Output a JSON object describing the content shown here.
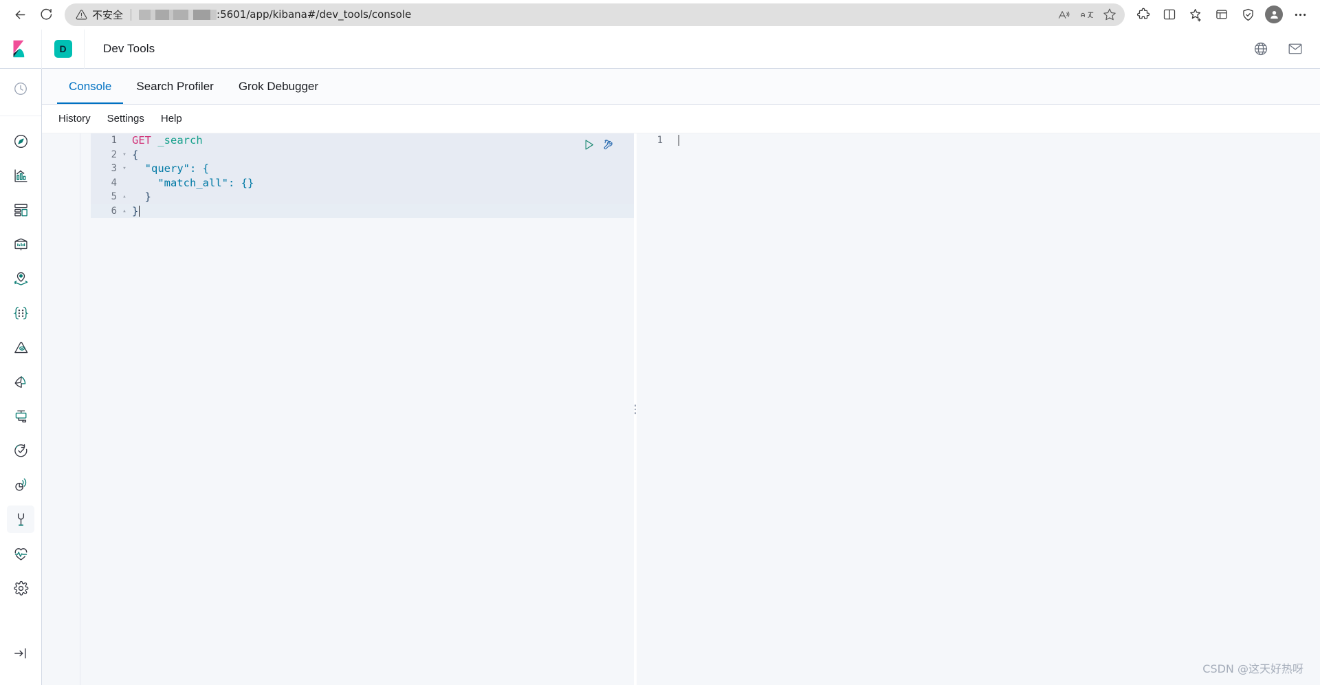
{
  "browser": {
    "back_label": "Back",
    "reload_label": "Refresh",
    "security_warning": "不安全",
    "url_text": ":5601/app/kibana#/dev_tools/console",
    "url_redacted": true,
    "addr_icons": [
      {
        "name": "read-aloud-icon",
        "glyph": "A"
      },
      {
        "name": "translate-icon",
        "glyph": "aあ"
      },
      {
        "name": "favorite-star-icon",
        "glyph": "☆"
      }
    ],
    "toolbar_icons": [
      {
        "name": "extensions-icon"
      },
      {
        "name": "split-screen-icon"
      },
      {
        "name": "favorites-icon"
      },
      {
        "name": "collections-icon"
      },
      {
        "name": "browser-essentials-icon"
      },
      {
        "name": "profile-avatar"
      },
      {
        "name": "settings-more-icon"
      }
    ]
  },
  "kibana_header": {
    "logo_name": "kibana-logo",
    "app_badge": "D",
    "title": "Dev Tools",
    "right_icons": [
      {
        "name": "help-globe-icon"
      },
      {
        "name": "news-feed-icon"
      }
    ]
  },
  "sidebar": {
    "top_item": {
      "label": "Recently viewed",
      "icon": "clock-icon"
    },
    "items": [
      {
        "label": "Discover",
        "icon": "compass-icon",
        "active": false
      },
      {
        "label": "Visualize",
        "icon": "visualize-chart-icon",
        "active": false
      },
      {
        "label": "Dashboard",
        "icon": "dashboard-grid-icon",
        "active": false
      },
      {
        "label": "Canvas",
        "icon": "canvas-presentation-icon",
        "active": false
      },
      {
        "label": "Maps",
        "icon": "maps-pin-layers-icon",
        "active": false
      },
      {
        "label": "Machine Learning",
        "icon": "machine-learning-icon",
        "active": false
      },
      {
        "label": "Infrastructure",
        "icon": "infrastructure-icon",
        "active": false
      },
      {
        "label": "Logs",
        "icon": "logs-icon",
        "active": false
      },
      {
        "label": "APM",
        "icon": "apm-icon",
        "active": false
      },
      {
        "label": "Uptime",
        "icon": "uptime-check-icon",
        "active": false
      },
      {
        "label": "SIEM",
        "icon": "siem-signal-icon",
        "active": false
      },
      {
        "label": "Dev Tools",
        "icon": "wrench-icon",
        "active": true
      },
      {
        "label": "Monitoring",
        "icon": "heartbeat-icon",
        "active": false
      },
      {
        "label": "Management",
        "icon": "gear-icon",
        "active": false
      }
    ],
    "collapse": {
      "label": "Collapse",
      "icon": "dock-collapse-icon"
    }
  },
  "tabs": [
    {
      "label": "Console",
      "active": true
    },
    {
      "label": "Search Profiler",
      "active": false
    },
    {
      "label": "Grok Debugger",
      "active": false
    }
  ],
  "console": {
    "menu": [
      {
        "label": "History"
      },
      {
        "label": "Settings"
      },
      {
        "label": "Help"
      }
    ],
    "actions": [
      {
        "name": "send-request-button",
        "label": "Click to send request"
      },
      {
        "name": "request-options-button",
        "label": "Request options"
      }
    ],
    "request_editor": {
      "lines": [
        {
          "num": "1",
          "fold": "",
          "method": "GET",
          "rest": " _search",
          "highlight": true
        },
        {
          "num": "2",
          "fold": "▾",
          "text": "{",
          "highlight": true
        },
        {
          "num": "3",
          "fold": "▾",
          "text": "  \"query\": {",
          "highlight": true
        },
        {
          "num": "4",
          "fold": "",
          "text": "    \"match_all\": {}",
          "highlight": true
        },
        {
          "num": "5",
          "fold": "▴",
          "text": "  }",
          "highlight": true
        },
        {
          "num": "6",
          "fold": "▴",
          "text": "}",
          "highlight": true,
          "cursor": true
        }
      ]
    },
    "response_editor": {
      "lines": [
        {
          "num": "1",
          "text": "",
          "cursor": true
        }
      ]
    }
  },
  "watermark": "CSDN @这天好热呀",
  "colors": {
    "accent": "#0071c2",
    "kibana_teal": "#00bfb3",
    "kibana_pink": "#f04e98",
    "editor_bg": "#f5f7fa",
    "line_highlight": "#e7edf4",
    "method_token": "#d13277",
    "url_token": "#16a08b",
    "key_token": "#0079a5"
  }
}
